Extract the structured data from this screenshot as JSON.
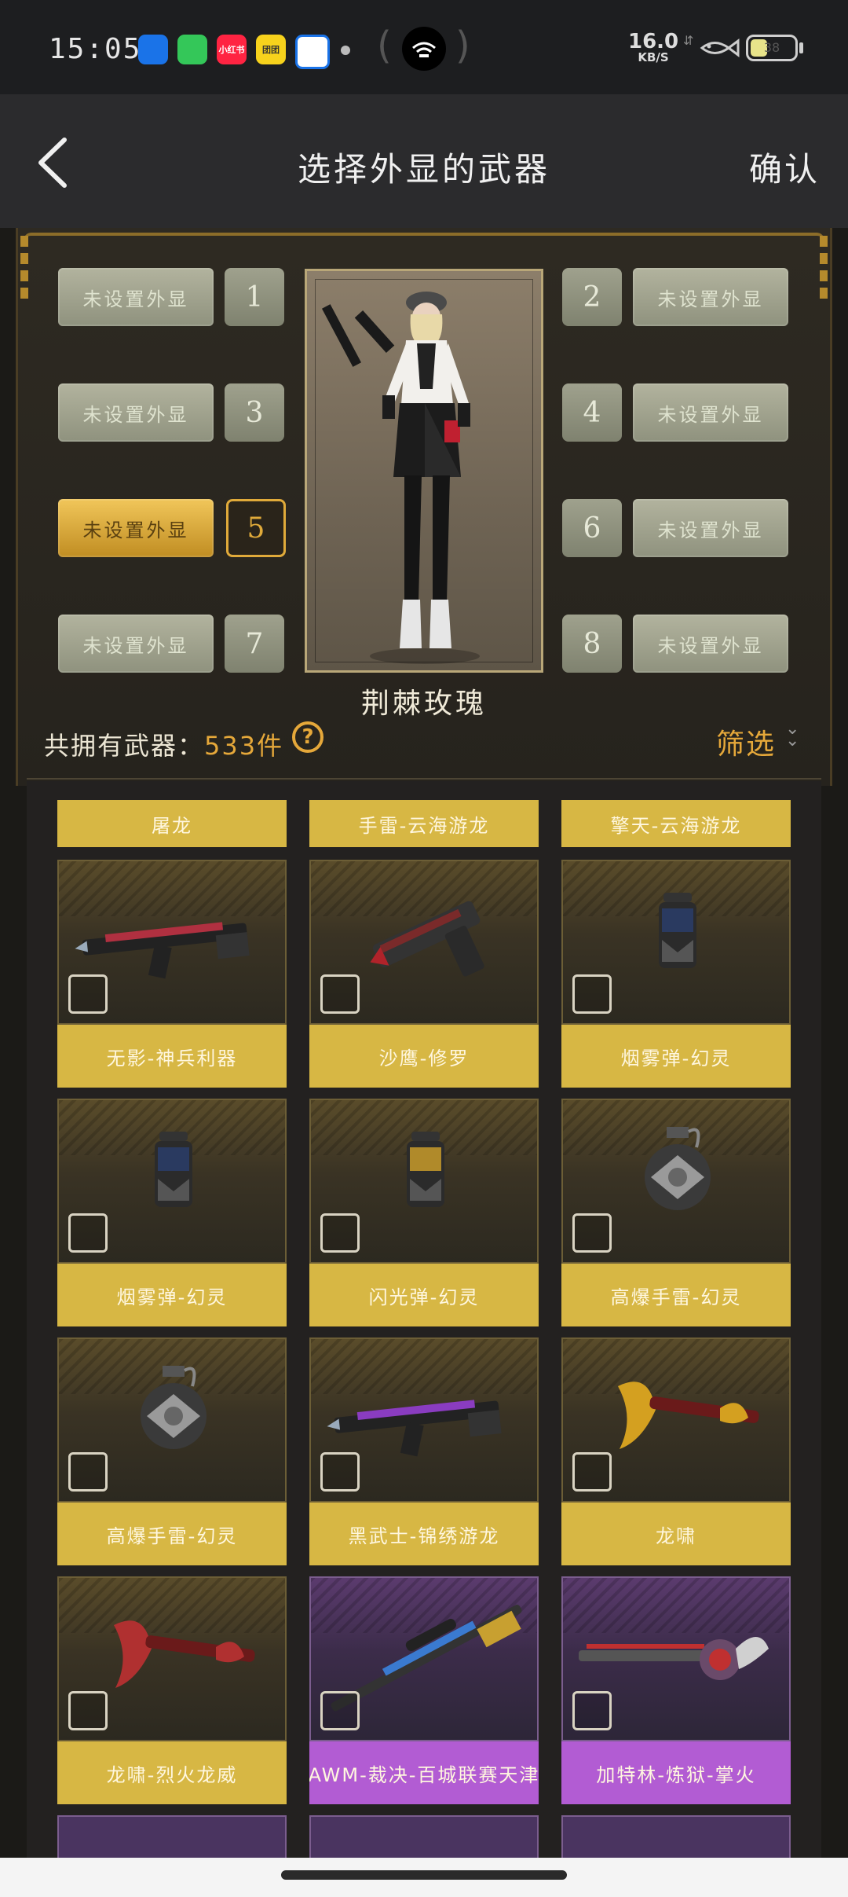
{
  "status_bar": {
    "time": "15:05",
    "apps": [
      {
        "name": "wifi-app-icon",
        "color": "#1a73e8",
        "text": ""
      },
      {
        "name": "message-app-icon",
        "color": "#34c759",
        "text": ""
      },
      {
        "name": "xiaohongshu-app-icon",
        "color": "#ff2442",
        "text": "小红书"
      },
      {
        "name": "yellow-app-icon",
        "color": "#f7d21c",
        "text": "团团"
      },
      {
        "name": "qq-browser-app-icon",
        "color": "#ffffff",
        "text": ""
      }
    ],
    "net_speed_value": "16.0",
    "net_speed_unit": "KB/S",
    "battery": "38",
    "battery_level": 0.38
  },
  "nav": {
    "title": "选择外显的武器",
    "confirm": "确认"
  },
  "slots": {
    "unset_label": "未设置外显",
    "left": [
      {
        "num": "1",
        "label": "未设置外显",
        "active": false
      },
      {
        "num": "3",
        "label": "未设置外显",
        "active": false
      },
      {
        "num": "5",
        "label": "未设置外显",
        "active": true
      },
      {
        "num": "7",
        "label": "未设置外显",
        "active": false
      }
    ],
    "right": [
      {
        "num": "2",
        "label": "未设置外显"
      },
      {
        "num": "4",
        "label": "未设置外显"
      },
      {
        "num": "6",
        "label": "未设置外显"
      },
      {
        "num": "8",
        "label": "未设置外显"
      }
    ]
  },
  "character": {
    "name": "荆棘玫瑰"
  },
  "owned": {
    "prefix": "共拥有武器：",
    "count": "533件",
    "help": "?"
  },
  "filter": {
    "label": "筛选"
  },
  "top_labels": [
    "屠龙",
    "手雷-云海游龙",
    "擎天-云海游龙"
  ],
  "items": [
    {
      "name": "无影-神兵利器",
      "rarity": "gold",
      "kind": "rifle",
      "palette": "#b03040"
    },
    {
      "name": "沙鹰-修罗",
      "rarity": "gold",
      "kind": "pistol",
      "palette": "#7a2a2a"
    },
    {
      "name": "烟雾弹-幻灵",
      "rarity": "gold",
      "kind": "canister",
      "palette": "#2a3a60"
    },
    {
      "name": "烟雾弹-幻灵",
      "rarity": "gold",
      "kind": "canister",
      "palette": "#2a3a60"
    },
    {
      "name": "闪光弹-幻灵",
      "rarity": "gold",
      "kind": "canister",
      "palette": "#b08a2a"
    },
    {
      "name": "高爆手雷-幻灵",
      "rarity": "gold",
      "kind": "grenade",
      "palette": "#666666"
    },
    {
      "name": "高爆手雷-幻灵",
      "rarity": "gold",
      "kind": "grenade",
      "palette": "#666666"
    },
    {
      "name": "黑武士-锦绣游龙",
      "rarity": "gold",
      "kind": "rifle",
      "palette": "#8a3cc0"
    },
    {
      "name": "龙啸",
      "rarity": "gold",
      "kind": "axe",
      "palette": "#d4a020"
    },
    {
      "name": "龙啸-烈火龙威",
      "rarity": "gold",
      "kind": "axe",
      "palette": "#b03030"
    },
    {
      "name": "AWM-裁决-百城联赛天津",
      "rarity": "purple",
      "kind": "sniper",
      "palette": "#3a7ad0"
    },
    {
      "name": "加特林-炼狱-掌火",
      "rarity": "purple",
      "kind": "gatling",
      "palette": "#c03030"
    }
  ]
}
